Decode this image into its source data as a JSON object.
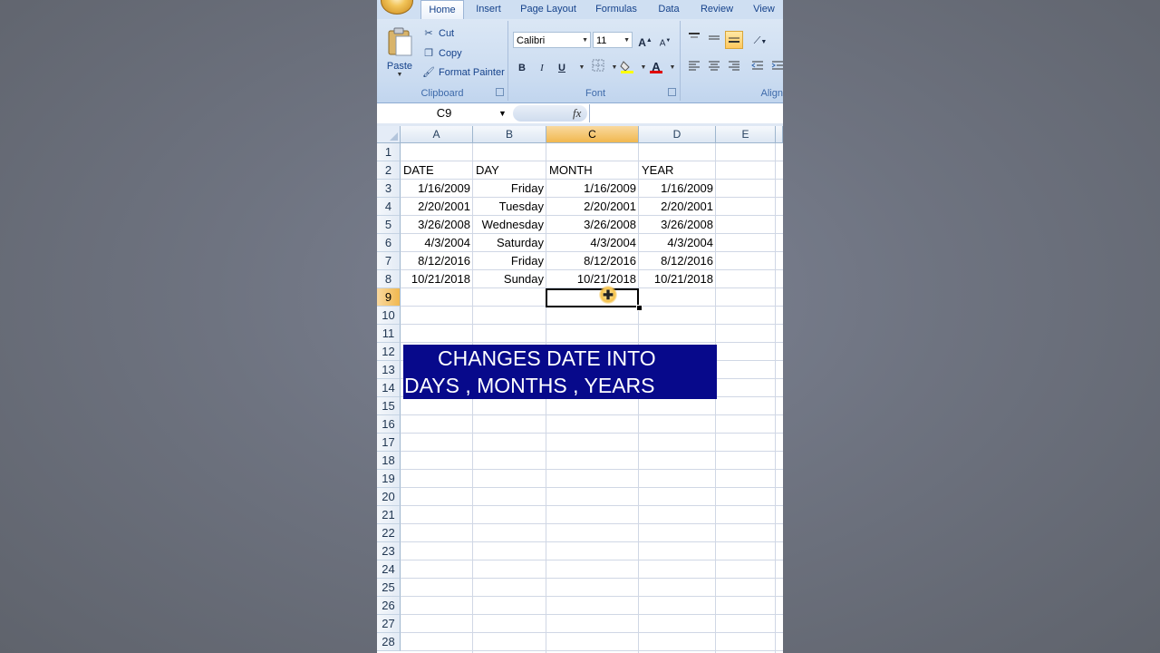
{
  "ribbon": {
    "tabs": [
      "Home",
      "Insert",
      "Page Layout",
      "Formulas",
      "Data",
      "Review",
      "View"
    ],
    "active_tab": "Home",
    "clipboard": {
      "paste": "Paste",
      "cut": "Cut",
      "copy": "Copy",
      "format_painter": "Format Painter",
      "label": "Clipboard"
    },
    "font": {
      "font_name": "Calibri",
      "font_size": "11",
      "bold": "B",
      "italic": "I",
      "underline": "U",
      "label": "Font"
    },
    "alignment": {
      "label": "Align"
    }
  },
  "formula_bar": {
    "name_box": "C9",
    "fx": "fx",
    "formula": ""
  },
  "sheet": {
    "columns": [
      "A",
      "B",
      "C",
      "D",
      "E"
    ],
    "selected_column": "C",
    "rows": [
      "1",
      "2",
      "3",
      "4",
      "5",
      "6",
      "7",
      "8",
      "9",
      "10",
      "11",
      "12",
      "13",
      "14",
      "15",
      "16",
      "17",
      "18",
      "19",
      "20",
      "21",
      "22",
      "23",
      "24",
      "25",
      "26",
      "27",
      "28"
    ],
    "selected_row": "9",
    "headers": {
      "date": "DATE",
      "day": "DAY",
      "month": "MONTH",
      "year": "YEAR"
    },
    "data": [
      {
        "date": "1/16/2009",
        "day": "Friday",
        "month": "1/16/2009",
        "year": "1/16/2009"
      },
      {
        "date": "2/20/2001",
        "day": "Tuesday",
        "month": "2/20/2001",
        "year": "2/20/2001"
      },
      {
        "date": "3/26/2008",
        "day": "Wednesday",
        "month": "3/26/2008",
        "year": "3/26/2008"
      },
      {
        "date": "4/3/2004",
        "day": "Saturday",
        "month": "4/3/2004",
        "year": "4/3/2004"
      },
      {
        "date": "8/12/2016",
        "day": "Friday",
        "month": "8/12/2016",
        "year": "8/12/2016"
      },
      {
        "date": "10/21/2018",
        "day": "Sunday",
        "month": "10/21/2018",
        "year": "10/21/2018"
      }
    ],
    "banner": {
      "line1": "CHANGES DATE INTO",
      "line2": "DAYS , MONTHS , YEARS"
    }
  },
  "colors": {
    "banner_bg": "#07098b",
    "selection_header": "#f1b84f",
    "ribbon_bg": "#cbdcf1"
  }
}
